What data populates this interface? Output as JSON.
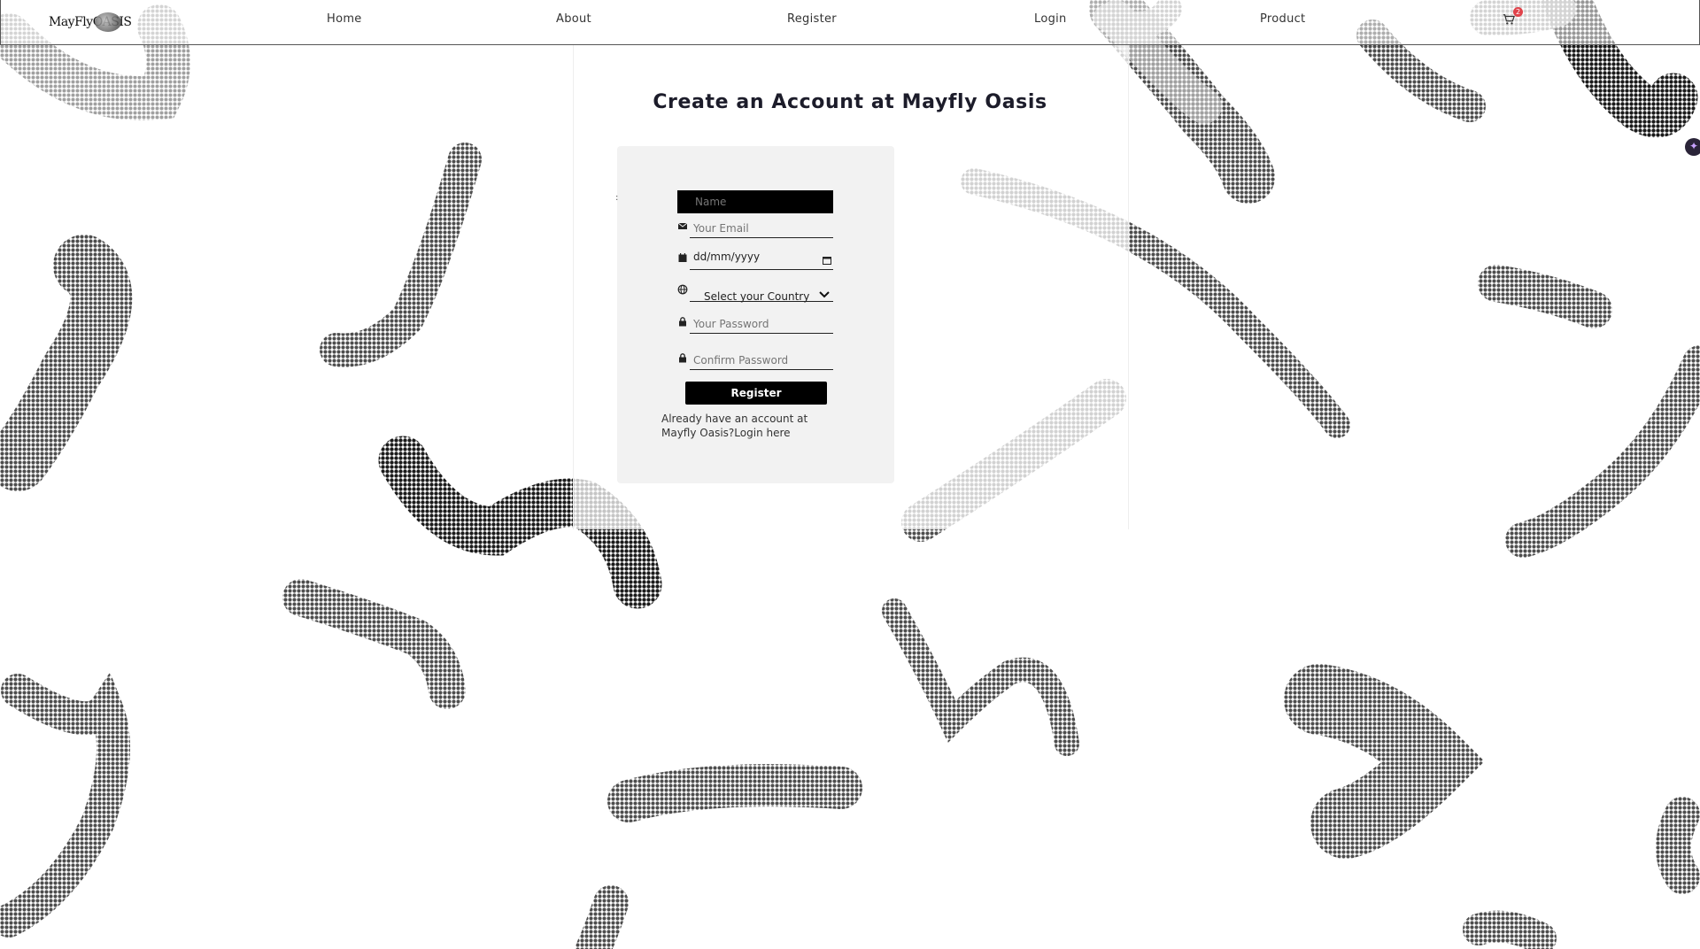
{
  "nav": {
    "logo_text": "MayFlyOASIS",
    "links": [
      {
        "label": "Home"
      },
      {
        "label": "About"
      },
      {
        "label": "Register"
      },
      {
        "label": "Login"
      },
      {
        "label": "Product"
      }
    ],
    "cart_count": "2"
  },
  "page": {
    "title": "Create an Account at Mayfly Oasis"
  },
  "form": {
    "name_placeholder": "Name",
    "email_placeholder": "Your Email",
    "dob_value": "dd/mm/yyyy",
    "country_selected": "Select your Country",
    "password_placeholder": "Your Password",
    "confirm_placeholder": "Confirm Password",
    "register_label": "Register",
    "login_prompt": "Already have an account at Mayfly Oasis?",
    "login_link": "Login here"
  },
  "colors": {
    "primary": "#000000",
    "card_bg": "#f2f2f2",
    "badge": "#e0424a",
    "stroke_dark": "#1a1a1a",
    "stroke_mid": "#4d4d4d",
    "stroke_light": "#9a9a9a"
  }
}
